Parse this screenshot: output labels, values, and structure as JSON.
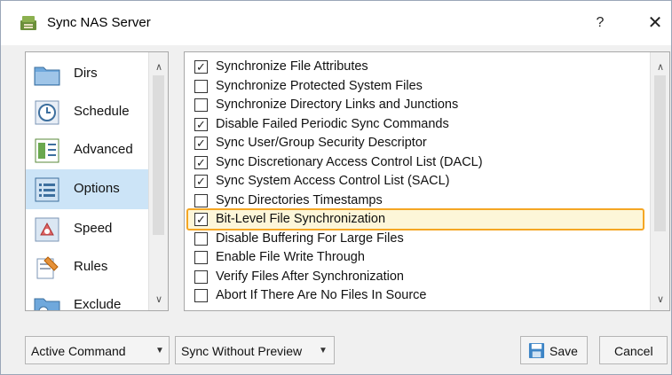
{
  "window": {
    "title": "Sync NAS Server",
    "help_label": "?",
    "close_label": "✕"
  },
  "sidebar": {
    "items": [
      {
        "label": "Dirs",
        "icon": "folder-icon"
      },
      {
        "label": "Schedule",
        "icon": "clock-icon"
      },
      {
        "label": "Advanced",
        "icon": "advanced-icon"
      },
      {
        "label": "Options",
        "icon": "options-list-icon",
        "selected": true
      },
      {
        "label": "Speed",
        "icon": "speed-icon"
      },
      {
        "label": "Rules",
        "icon": "rules-icon"
      },
      {
        "label": "Exclude",
        "icon": "exclude-icon"
      }
    ],
    "scroll_up": "∧",
    "scroll_down": "∨"
  },
  "options": {
    "items": [
      {
        "label": "Synchronize File Attributes",
        "checked": true
      },
      {
        "label": "Synchronize Protected System Files",
        "checked": false
      },
      {
        "label": "Synchronize Directory Links and Junctions",
        "checked": false
      },
      {
        "label": "Disable Failed Periodic Sync Commands",
        "checked": true
      },
      {
        "label": "Sync User/Group Security Descriptor",
        "checked": true
      },
      {
        "label": "Sync Discretionary Access Control List (DACL)",
        "checked": true
      },
      {
        "label": "Sync System Access Control List (SACL)",
        "checked": true
      },
      {
        "label": "Sync Directories Timestamps",
        "checked": false
      },
      {
        "label": "Bit-Level File Synchronization",
        "checked": true,
        "highlighted": true
      },
      {
        "label": "Disable Buffering For Large Files",
        "checked": false
      },
      {
        "label": "Enable File Write Through",
        "checked": false
      },
      {
        "label": "Verify Files After Synchronization",
        "checked": false
      },
      {
        "label": "Abort If There Are No Files In Source",
        "checked": false
      }
    ],
    "scroll_up": "∧",
    "scroll_down": "∨"
  },
  "bottom": {
    "active_command_label": "Active Command",
    "sync_preview_label": "Sync Without Preview",
    "save_label": "Save",
    "cancel_label": "Cancel"
  },
  "colors": {
    "highlight_border": "#f5a623",
    "selected_bg": "#cce4f7"
  }
}
